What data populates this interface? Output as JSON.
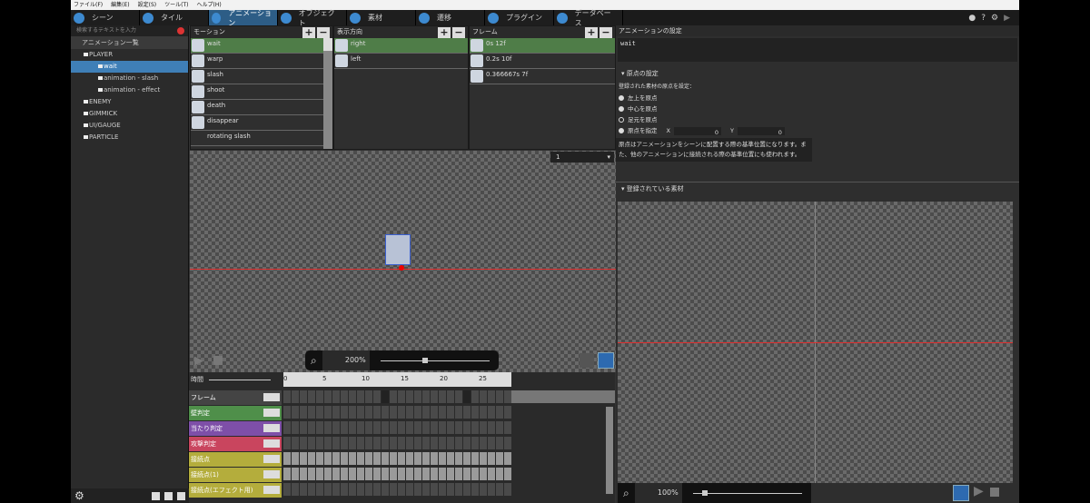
{
  "menu": [
    "ファイル(F)",
    "編集(E)",
    "設定(S)",
    "ツール(T)",
    "ヘルプ(H)"
  ],
  "tabs": [
    "シーン",
    "タイル",
    "アニメーション",
    "オブジェクト",
    "素材",
    "遷移",
    "プラグイン",
    "データベース"
  ],
  "sidebar": {
    "search_placeholder": "検索するテキストを入力",
    "header": "アニメーション一覧",
    "tree": [
      {
        "label": "PLAYER",
        "depth": 1,
        "folder": true
      },
      {
        "label": "wait",
        "depth": 2,
        "selected": true
      },
      {
        "label": "animation - slash",
        "depth": 2
      },
      {
        "label": "animation - effect",
        "depth": 2
      },
      {
        "label": "ENEMY",
        "depth": 1,
        "folder": true
      },
      {
        "label": "GIMMICK",
        "depth": 1,
        "folder": true
      },
      {
        "label": "UI/GAUGE",
        "depth": 1,
        "folder": true
      },
      {
        "label": "PARTICLE",
        "depth": 1,
        "folder": true
      }
    ]
  },
  "motion": {
    "title": "モーション",
    "items": [
      "wait",
      "warp",
      "slash",
      "shoot",
      "death",
      "disappear",
      "rotating slash"
    ]
  },
  "direction": {
    "title": "表示方向",
    "items": [
      "right",
      "left"
    ]
  },
  "frames": {
    "title": "フレーム",
    "items": [
      "0s 12f",
      "0.2s 10f",
      "0.366667s 7f"
    ]
  },
  "canvas": {
    "frame_select": "1",
    "zoom": "200%",
    "zoom_right": "100%"
  },
  "timeline": {
    "time_label": "時間",
    "ticks": [
      "0",
      "5",
      "10",
      "15",
      "20",
      "25"
    ],
    "tracks": [
      {
        "label": "フレーム",
        "color": "#444444"
      },
      {
        "label": "壁判定",
        "color": "#4f8f4a"
      },
      {
        "label": "当たり判定",
        "color": "#7e4fa8"
      },
      {
        "label": "攻撃判定",
        "color": "#c9455e"
      },
      {
        "label": "接続点",
        "color": "#b4ad3c"
      },
      {
        "label": "接続点(1)",
        "color": "#b4ad3c"
      },
      {
        "label": "接続点(エフェクト用)",
        "color": "#b4ad3c"
      }
    ]
  },
  "right": {
    "title": "アニメーションの設定",
    "name_value": "wait",
    "origin_section": "原点の設定",
    "origin_prompt": "登録された素材の原点を設定：",
    "options": [
      "左上を原点",
      "中心を原点",
      "足元を原点",
      "原点を指定"
    ],
    "selected_option": 2,
    "x_label": "X",
    "y_label": "Y",
    "x_value": "0",
    "y_value": "0",
    "help": "原点はアニメーションをシーンに配置する際の基準位置になります。また、他のアニメーションに接続される際の基準位置にも使われます。",
    "materials_section": "登録されている素材"
  }
}
